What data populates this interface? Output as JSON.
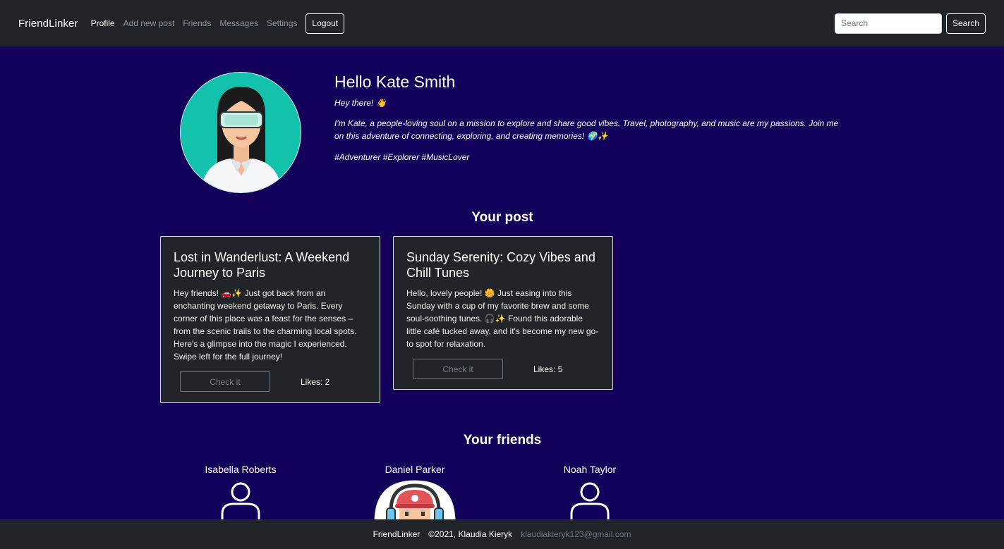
{
  "navbar": {
    "brand": "FriendLinker",
    "links": [
      {
        "label": "Profile",
        "active": true
      },
      {
        "label": "Add new post",
        "active": false
      },
      {
        "label": "Friends",
        "active": false
      },
      {
        "label": "Messages",
        "active": false
      },
      {
        "label": "Settings",
        "active": false
      }
    ],
    "logout_label": "Logout",
    "search_placeholder": "Search",
    "search_button": "Search"
  },
  "profile": {
    "greeting": "Hello Kate Smith",
    "tagline": "Hey there! 👋",
    "bio": "I'm Kate, a people-loving soul on a mission to explore and share good vibes. Travel, photography, and music are my passions. Join me on this adventure of connecting, exploring, and creating memories! 🌍✨",
    "hashtags": "#Adventurer #Explorer #MusicLover"
  },
  "posts_section": {
    "title": "Your post",
    "posts": [
      {
        "title": "Lost in Wanderlust: A Weekend Journey to Paris",
        "body": "Hey friends! 🚗✨ Just got back from an enchanting weekend getaway to Paris. Every corner of this place was a feast for the senses – from the scenic trails to the charming local spots. Here's a glimpse into the magic I experienced. Swipe left for the full journey!",
        "button": "Check it",
        "likes": "Likes: 2"
      },
      {
        "title": "Sunday Serenity: Cozy Vibes and Chill Tunes",
        "body": "Hello, lovely people! 🌼 Just easing into this Sunday with a cup of my favorite brew and some soul-soothing tunes. 🎧✨ Found this adorable little café tucked away, and it's become my new go-to spot for relaxation.",
        "button": "Check it",
        "likes": "Likes: 5"
      }
    ]
  },
  "friends_section": {
    "title": "Your friends",
    "friends": [
      {
        "name": "Isabella Roberts",
        "icon": "person-outline-icon"
      },
      {
        "name": "Daniel Parker",
        "icon": "avatar-image"
      },
      {
        "name": "Noah Taylor",
        "icon": "person-outline-icon"
      }
    ]
  },
  "footer": {
    "brand": "FriendLinker",
    "copyright": "©2021, Klaudia Kieryk",
    "email": "klaudiakieryk123@gmail.com"
  },
  "colors": {
    "page_bg": "#12005a",
    "navbar_bg": "#212529",
    "card_bg": "#212529",
    "avatar_bg": "#13c2ad"
  }
}
